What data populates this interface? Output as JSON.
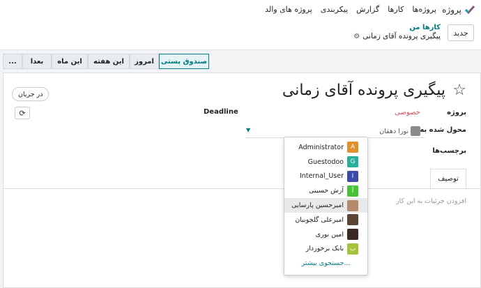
{
  "nav": {
    "brand": "پروژه",
    "brand_color": "#875a7b",
    "menu": [
      "پروژه‌ها",
      "کارها",
      "گزارش",
      "پیکربندی",
      "پروژه های والد"
    ]
  },
  "control": {
    "new_label": "جدید",
    "breadcrumb_parent": "کارها من",
    "breadcrumb_current": "پیگیری پرونده آقای زمانی",
    "gear_icon": "gear-icon"
  },
  "stages": [
    "صندوق پستی",
    "امروز",
    "این هفته",
    "این ماه",
    "بعدا",
    "..."
  ],
  "form": {
    "title": "پیگیری پرونده آقای زمانی",
    "kanban_state": "در جریان",
    "deadline_label": "Deadline",
    "project_label": "پروژه",
    "project_value": "خصوصی",
    "assignee_label": "محول شده به",
    "assignee_value": "نورا دهقان",
    "tags_label": "برچسب‌ها",
    "tab_description": "توصیف",
    "description_placeholder": "افزودن جزئیات به این کار"
  },
  "dropdown": {
    "items": [
      {
        "label": "Administrator",
        "initial": "A",
        "color": "#e0902a"
      },
      {
        "label": "Guestodoo",
        "initial": "G",
        "color": "#2ab09a"
      },
      {
        "label": "Internal_User",
        "initial": "I",
        "color": "#3c4aa8"
      },
      {
        "label": "آرش حسینی",
        "initial": "آ",
        "color": "#49c23a"
      },
      {
        "label": "امیرحسین پارسایی",
        "initial": "",
        "color": "#b58a6a"
      },
      {
        "label": "امیرعلی گلچوبیان",
        "initial": "",
        "color": "#5b4636"
      },
      {
        "label": "امین نوری",
        "initial": "",
        "color": "#3a2a22"
      },
      {
        "label": "بابک برخوردار",
        "initial": "ب",
        "color": "#a4c23a"
      }
    ],
    "more": "جستجوی بیشتر..."
  }
}
